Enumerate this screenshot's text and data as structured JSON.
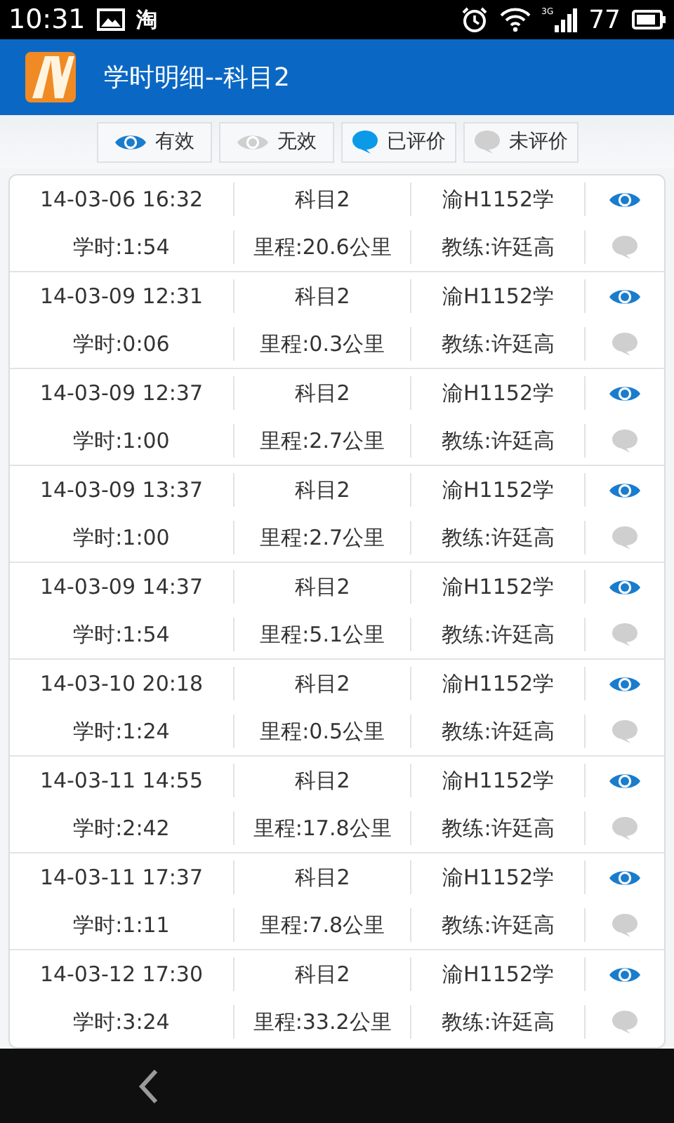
{
  "status_bar": {
    "time": "10:31",
    "app_badge": "淘",
    "network": "3G",
    "battery": "77"
  },
  "app_bar": {
    "title": "学时明细--科目2"
  },
  "legend": [
    {
      "kind": "eye",
      "on": true,
      "label": "有效"
    },
    {
      "kind": "eye",
      "on": false,
      "label": "无效"
    },
    {
      "kind": "bubble",
      "on": true,
      "label": "已评价"
    },
    {
      "kind": "bubble",
      "on": false,
      "label": "未评价"
    }
  ],
  "records": [
    {
      "datetime": "14-03-06 16:32",
      "subject": "科目2",
      "car": "渝H1152学",
      "valid": true,
      "hours": "学时:1:54",
      "distance": "里程:20.6公里",
      "coach": "教练:许廷高",
      "rated": false
    },
    {
      "datetime": "14-03-09 12:31",
      "subject": "科目2",
      "car": "渝H1152学",
      "valid": true,
      "hours": "学时:0:06",
      "distance": "里程:0.3公里",
      "coach": "教练:许廷高",
      "rated": false
    },
    {
      "datetime": "14-03-09 12:37",
      "subject": "科目2",
      "car": "渝H1152学",
      "valid": true,
      "hours": "学时:1:00",
      "distance": "里程:2.7公里",
      "coach": "教练:许廷高",
      "rated": false
    },
    {
      "datetime": "14-03-09 13:37",
      "subject": "科目2",
      "car": "渝H1152学",
      "valid": true,
      "hours": "学时:1:00",
      "distance": "里程:2.7公里",
      "coach": "教练:许廷高",
      "rated": false
    },
    {
      "datetime": "14-03-09 14:37",
      "subject": "科目2",
      "car": "渝H1152学",
      "valid": true,
      "hours": "学时:1:54",
      "distance": "里程:5.1公里",
      "coach": "教练:许廷高",
      "rated": false
    },
    {
      "datetime": "14-03-10 20:18",
      "subject": "科目2",
      "car": "渝H1152学",
      "valid": true,
      "hours": "学时:1:24",
      "distance": "里程:0.5公里",
      "coach": "教练:许廷高",
      "rated": false
    },
    {
      "datetime": "14-03-11 14:55",
      "subject": "科目2",
      "car": "渝H1152学",
      "valid": true,
      "hours": "学时:2:42",
      "distance": "里程:17.8公里",
      "coach": "教练:许廷高",
      "rated": false
    },
    {
      "datetime": "14-03-11 17:37",
      "subject": "科目2",
      "car": "渝H1152学",
      "valid": true,
      "hours": "学时:1:11",
      "distance": "里程:7.8公里",
      "coach": "教练:许廷高",
      "rated": false
    },
    {
      "datetime": "14-03-12 17:30",
      "subject": "科目2",
      "car": "渝H1152学",
      "valid": true,
      "hours": "学时:3:24",
      "distance": "里程:33.2公里",
      "coach": "教练:许廷高",
      "rated": false
    }
  ]
}
